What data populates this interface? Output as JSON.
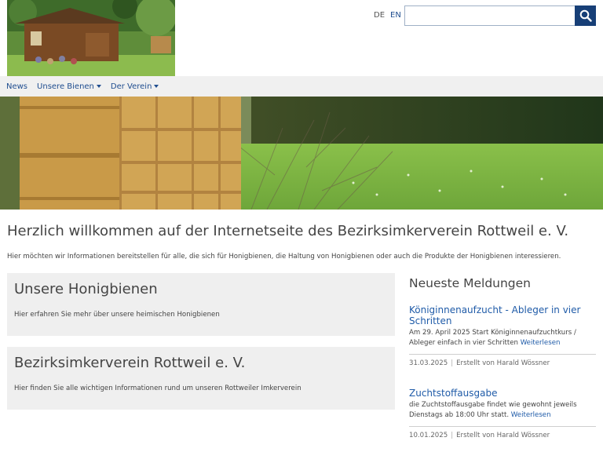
{
  "header": {
    "lang_de": "DE",
    "lang_en": "EN",
    "search_placeholder": ""
  },
  "nav": {
    "items": [
      {
        "label": "News",
        "has_dropdown": false
      },
      {
        "label": "Unsere Bienen",
        "has_dropdown": true
      },
      {
        "label": "Der Verein",
        "has_dropdown": true
      }
    ]
  },
  "main": {
    "title": "Herzlich willkommen auf der Internetseite des Bezirksimkerverein Rottweil e. V.",
    "intro": "Hier möchten wir Informationen bereitstellen für alle, die sich für Honigbienen, die Haltung von Honigbienen oder auch die Produkte der Honigbienen interessieren.",
    "cards": [
      {
        "title": "Unsere Honigbienen",
        "text": "Hier erfahren Sie mehr über unsere heimischen Honigbienen"
      },
      {
        "title": "Bezirksimkerverein Rottweil e. V.",
        "text": "Hier finden Sie alle wichtigen Informationen rund um unseren Rottweiler Imkerverein"
      }
    ]
  },
  "sidebar": {
    "title": "Neueste Meldungen",
    "news": [
      {
        "title": "Königinnenaufzucht - Ableger in vier Schritten",
        "text": "Am 29. April 2025 Start Königinnenaufzuchtkurs / Ableger einfach in vier Schritten",
        "more": "Weiterlesen",
        "date": "31.03.2025",
        "author": "Erstellt von Harald Wössner"
      },
      {
        "title": "Zuchtstoffausgabe",
        "text": "die Zuchtstoffausgabe findet wie gewohnt jeweils Dienstags ab 18:00 Uhr statt.",
        "more": "Weiterlesen",
        "date": "10.01.2025",
        "author": "Erstellt von Harald Wössner"
      }
    ]
  },
  "colors": {
    "accent": "#173f77",
    "link": "#1f5ba8",
    "nav_bg": "#f0f0f0",
    "card_bg": "#efefef"
  },
  "icons": {
    "search": "search-icon",
    "dropdown": "caret-down-icon"
  }
}
